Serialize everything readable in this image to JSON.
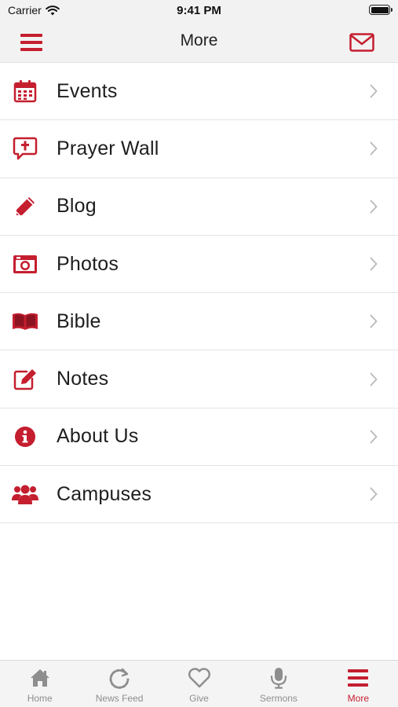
{
  "colors": {
    "accent": "#c41e2f",
    "chevron": "#bdbdbd",
    "tab_inactive": "#8e8e8e"
  },
  "status_bar": {
    "carrier": "Carrier",
    "time": "9:41 PM"
  },
  "header": {
    "title": "More",
    "left_icon": "hamburger-menu-icon",
    "right_icon": "mail-icon"
  },
  "menu": {
    "items": [
      {
        "label": "Events",
        "icon": "calendar-icon"
      },
      {
        "label": "Prayer Wall",
        "icon": "prayer-bubble-icon"
      },
      {
        "label": "Blog",
        "icon": "pencil-icon"
      },
      {
        "label": "Photos",
        "icon": "camera-icon"
      },
      {
        "label": "Bible",
        "icon": "book-icon"
      },
      {
        "label": "Notes",
        "icon": "edit-note-icon"
      },
      {
        "label": "About Us",
        "icon": "info-icon"
      },
      {
        "label": "Campuses",
        "icon": "users-icon"
      }
    ]
  },
  "tabs": {
    "items": [
      {
        "label": "Home",
        "icon": "home-icon"
      },
      {
        "label": "News Feed",
        "icon": "refresh-icon"
      },
      {
        "label": "Give",
        "icon": "heart-icon"
      },
      {
        "label": "Sermons",
        "icon": "microphone-icon"
      },
      {
        "label": "More",
        "icon": "hamburger-menu-icon",
        "active": true
      }
    ]
  }
}
